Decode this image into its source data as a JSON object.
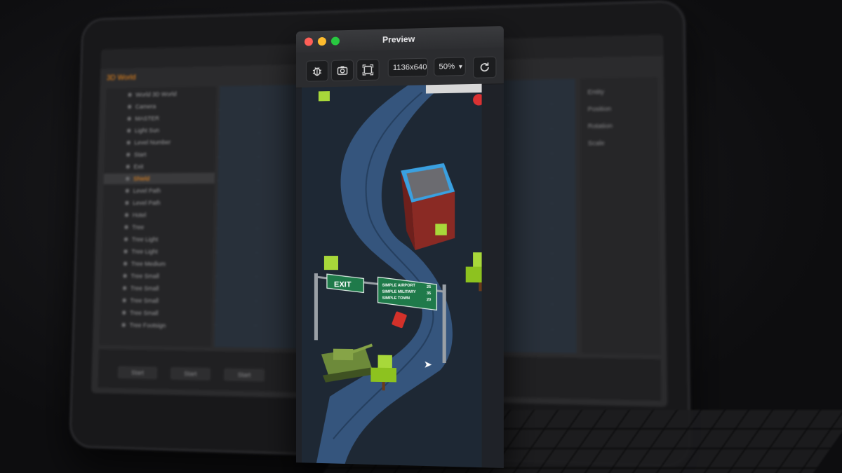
{
  "editor": {
    "tab_label": "3D World",
    "hierarchy": [
      {
        "label": "World 3D World",
        "selected": false
      },
      {
        "label": "Camera",
        "selected": false
      },
      {
        "label": "MASTER",
        "selected": false
      },
      {
        "label": "Light Sun",
        "selected": false
      },
      {
        "label": "Level Number",
        "selected": false
      },
      {
        "label": "Start",
        "selected": false
      },
      {
        "label": "Exit",
        "selected": false
      },
      {
        "label": "Shield",
        "selected": true
      },
      {
        "label": "Level Path",
        "selected": false
      },
      {
        "label": "Level Path",
        "selected": false
      },
      {
        "label": "Hotel",
        "selected": false
      },
      {
        "label": "Tree",
        "selected": false
      },
      {
        "label": "Tree Light",
        "selected": false
      },
      {
        "label": "Tree Light",
        "selected": false
      },
      {
        "label": "Tree Medium",
        "selected": false
      },
      {
        "label": "Tree Small",
        "selected": false
      },
      {
        "label": "Tree Small",
        "selected": false
      },
      {
        "label": "Tree Small",
        "selected": false
      },
      {
        "label": "Tree Small",
        "selected": false
      },
      {
        "label": "Tree Footsign",
        "selected": false
      }
    ],
    "inspector": [
      "Entity",
      "Position",
      "Rotation",
      "Scale"
    ],
    "timeline_buttons": [
      "Start",
      "Start",
      "Start"
    ]
  },
  "preview": {
    "title": "Preview",
    "resolution": "1136x640",
    "zoom": "50%",
    "toolbar_icons": [
      "bug-icon",
      "camera-icon",
      "fit-screen-icon",
      "reload-icon"
    ],
    "game": {
      "exit_sign": "EXIT",
      "direction_sign": [
        {
          "place": "SIMPLE AIRPORT",
          "distance": "25"
        },
        {
          "place": "SIMPLE MILITARY",
          "distance": "35"
        },
        {
          "place": "SIMPLE TOWN",
          "distance": "20"
        }
      ],
      "colors": {
        "road": "#35557d",
        "ground": "#1e2834",
        "tree": "#a8d83a",
        "building": "#8a2a24",
        "sign": "#1f7a4a",
        "car": "#d3312a",
        "tank": "#6d8a3a"
      }
    }
  }
}
